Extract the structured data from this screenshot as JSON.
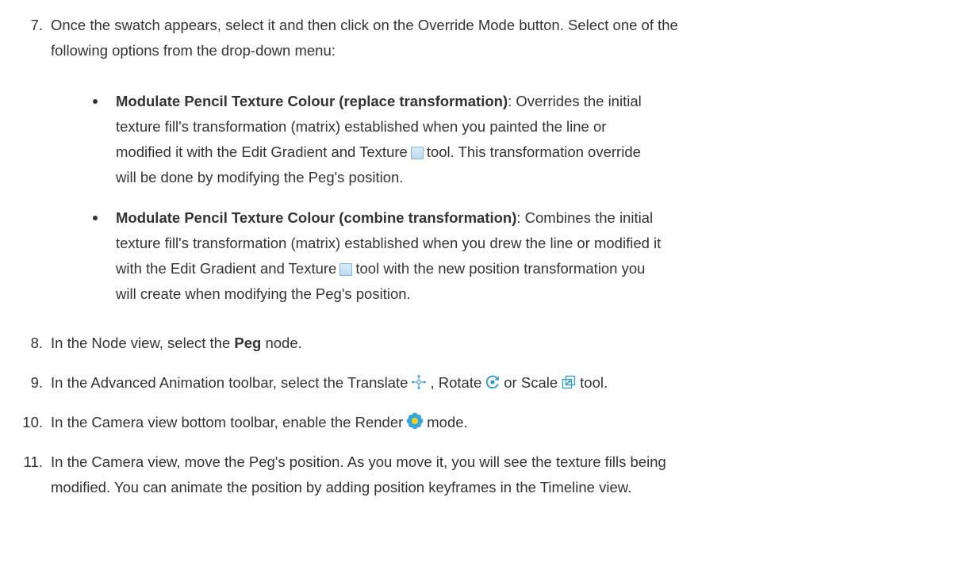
{
  "steps": {
    "s7": {
      "number": "7.",
      "line1": "Once the swatch appears, select it and then click on the Override Mode button. Select one of the",
      "line2": "following options from the drop-down menu:"
    },
    "bullets": [
      {
        "title": "Modulate Pencil Texture Colour (replace transformation)",
        "after_title": ": Overrides the initial",
        "line2": "texture fill's transformation (matrix) established when you painted the line or",
        "line3_before_icon": "modified it with the Edit Gradient and Texture",
        "line3_after_icon": "tool. This transformation override",
        "line4": "will be done by modifying the Peg's position."
      },
      {
        "title": "Modulate Pencil Texture Colour (combine transformation)",
        "after_title": ": Combines the initial",
        "line2": "texture fill's transformation (matrix) established when you drew the line or modified it",
        "line3_before_icon": "with the Edit Gradient and Texture",
        "line3_after_icon": "tool with the new position transformation you",
        "line4": "will create when modifying the Peg's position."
      }
    ],
    "s8": {
      "number": "8.",
      "before": "In the Node view, select the",
      "bold": "Peg",
      "after": "node."
    },
    "s9": {
      "number": "9.",
      "part1": "In the Advanced Animation toolbar, select the Translate",
      "part2": ", Rotate",
      "part3": "or Scale",
      "part4": "tool."
    },
    "s10": {
      "number": "10.",
      "before": "In the Camera view bottom toolbar, enable the Render",
      "after": "mode."
    },
    "s11": {
      "number": "11.",
      "line1": "In the Camera view, move the Peg's position. As you move it, you will see the texture fills being",
      "line2": "modified. You can animate the position by adding position keyframes in the Timeline view."
    }
  },
  "icons": [
    "swatch-icon",
    "translate-icon",
    "rotate-icon",
    "scale-icon",
    "render-icon"
  ],
  "colors": {
    "text": "#333333",
    "icon_blue": "#2f9bc9",
    "render_blue": "#35a6dc",
    "render_yellow": "#f5d21c"
  }
}
